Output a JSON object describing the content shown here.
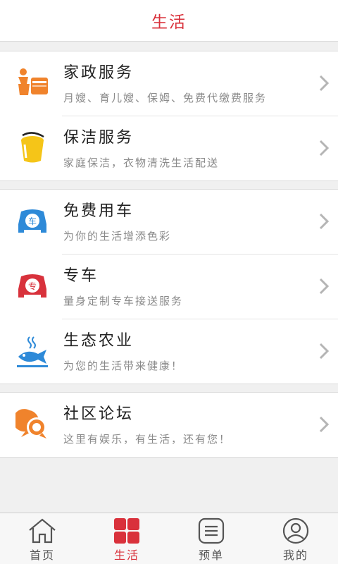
{
  "header": {
    "title": "生活"
  },
  "groups": [
    {
      "items": [
        {
          "title": "家政服务",
          "subtitle": "月嫂、育儿嫂、保姆、免费代缴费服务",
          "icon": "housekeeping-icon"
        },
        {
          "title": "保洁服务",
          "subtitle": "家庭保洁，衣物清洗生活配送",
          "icon": "cleaning-bucket-icon"
        }
      ]
    },
    {
      "items": [
        {
          "title": "免费用车",
          "subtitle": "为你的生活增添色彩",
          "icon": "free-car-icon",
          "badge": "车"
        },
        {
          "title": "专车",
          "subtitle": "量身定制专车接送服务",
          "icon": "private-car-icon",
          "badge": "专"
        },
        {
          "title": "生态农业",
          "subtitle": "为您的生活带来健康！",
          "icon": "fish-icon"
        }
      ]
    },
    {
      "items": [
        {
          "title": "社区论坛",
          "subtitle": "这里有娱乐，有生活，还有您！",
          "icon": "forum-chat-icon"
        }
      ]
    }
  ],
  "tabbar": [
    {
      "label": "首页",
      "icon": "home-icon",
      "active": false
    },
    {
      "label": "生活",
      "icon": "life-grid-icon",
      "active": true
    },
    {
      "label": "预单",
      "icon": "order-list-icon",
      "active": false
    },
    {
      "label": "我的",
      "icon": "profile-icon",
      "active": false
    }
  ],
  "colors": {
    "accent": "#d9313b",
    "orange": "#f0832c",
    "yellow": "#f5c518",
    "blue": "#2e8ad8",
    "red": "#d8323c"
  }
}
